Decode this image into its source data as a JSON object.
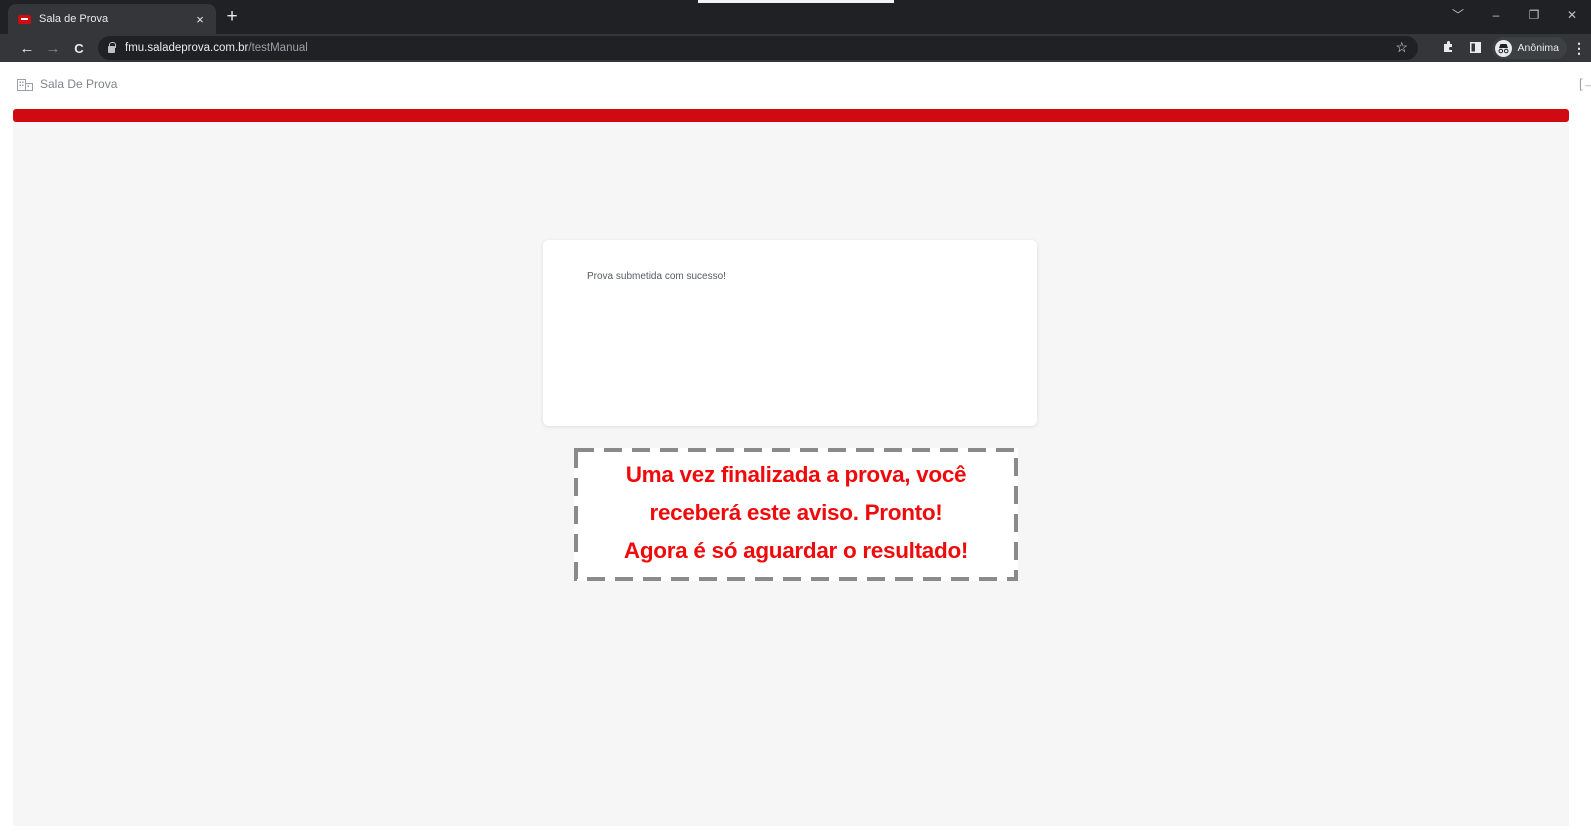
{
  "browser": {
    "tab": {
      "title": "Sala de Prova",
      "close": "×",
      "new_tab": "+"
    },
    "window_controls": [
      "﹀",
      "–",
      "❐",
      "✕"
    ],
    "nav": {
      "back": "←",
      "forward": "→",
      "reload": "C"
    },
    "url": {
      "host": "fmu.saladeprova.com.br",
      "path": "/testManual"
    },
    "bookmark_icon": "☆",
    "toolbar_icons": {
      "extensions": "puzzle-icon",
      "sidepanel": "sidepanel-icon"
    },
    "profile_label": "Anônima",
    "menu": "⋮"
  },
  "app": {
    "brand_label": "Sala De Prova",
    "accent_color": "#d10a11",
    "logout_icon": "[→"
  },
  "card": {
    "message": "Prova submetida com sucesso!"
  },
  "callout": {
    "lines": [
      "Uma vez finalizada a prova, você",
      "receberá este aviso. Pronto!",
      "Agora é só aguardar o resultado!"
    ],
    "color": "#ef0b0b"
  }
}
